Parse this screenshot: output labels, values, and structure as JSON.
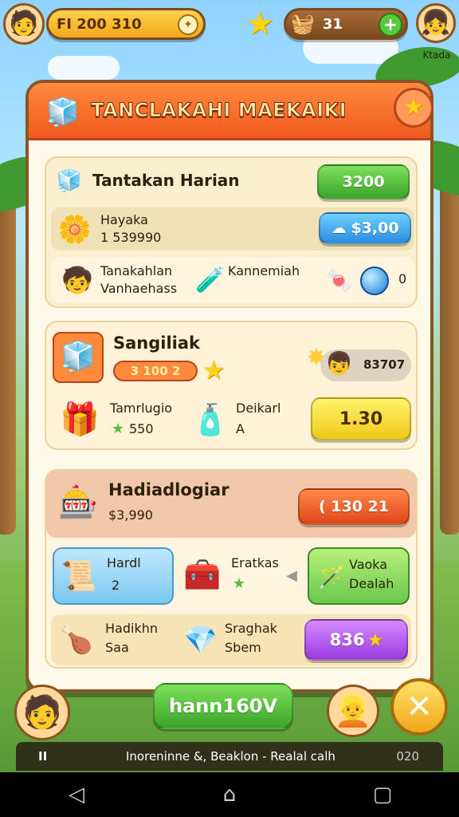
{
  "hud": {
    "coins_text": "FI 200 310",
    "items_count": "31",
    "plus_label": "+",
    "player_name": "Ktada"
  },
  "panel": {
    "title": "TANCLAKAHI MAEKAIKI"
  },
  "daily": {
    "title": "Tantakan Harian",
    "title_button": "3200",
    "row1_name": "Hayaka",
    "row1_sub": "1 539990",
    "row1_button": "$3,00",
    "row2_left_line1": "Tanakahlan",
    "row2_left_line2": "Vanhaehass",
    "row2_mid": "Kannemiah",
    "row2_count": "0"
  },
  "special": {
    "title": "Sangiliak",
    "price_badge": "3 100 2",
    "right_badge": "83707",
    "item1_name": "Tamrlugio",
    "item1_value": "550",
    "item2_name": "Deikarl",
    "item2_value": "A",
    "buy_button": "1.30"
  },
  "gifts": {
    "title": "Hadiadlogiar",
    "subtitle": "$3,990",
    "button": "( 130 21",
    "card1_name": "Hardl",
    "card1_value": "2",
    "card2_name": "Eratkas",
    "card3_line1": "Vaoka",
    "card3_line2": "Dealah",
    "row2_item1_line1": "Hadikhn",
    "row2_item1_line2": "Saa",
    "row2_item2_line1": "Sraghak",
    "row2_item2_line2": "Sbem",
    "row2_button": "836"
  },
  "bottom": {
    "main_button": "hann160V",
    "status_left": "II",
    "status_text": "Inoreninne &, Beaklon - Realal calh",
    "status_right": "020"
  },
  "colors": {
    "header_orange": "#f05a1e",
    "panel_cream": "#fff9ea",
    "accent_green": "#3aa52a"
  }
}
